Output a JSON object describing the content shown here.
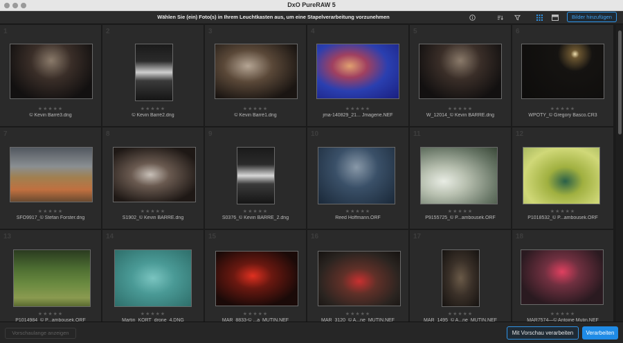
{
  "window": {
    "title": "DxO PureRAW 5"
  },
  "toolbar": {
    "instruction": "Wählen Sie (ein) Foto(s) in Ihrem Leuchtkasten aus, um eine Stapelverarbeitung vorzunehmen",
    "add_button": "Bilder hinzufügen",
    "icons": [
      "info-icon",
      "sort-icon",
      "filter-icon",
      "grid-view-icon",
      "compare-view-icon"
    ]
  },
  "rating_glyphs": "★★★★★",
  "images": [
    {
      "num": "1",
      "name": "© Kevin Barré3.dng"
    },
    {
      "num": "2",
      "name": "© Kevin Barré2.dng"
    },
    {
      "num": "3",
      "name": "© Kevin Barré1.dng"
    },
    {
      "num": "4",
      "name": "jma-140829_21... Jmagerie.NEF"
    },
    {
      "num": "5",
      "name": "W_12014_© Kevin BARRE.dng"
    },
    {
      "num": "6",
      "name": "WPOTY_© Gregory Basco.CR3"
    },
    {
      "num": "7",
      "name": "SFO9917_© Stefan Forster.dng"
    },
    {
      "num": "8",
      "name": "S1902_© Kevin BARRE.dng"
    },
    {
      "num": "9",
      "name": "S0376_© Kevin BARRE_2.dng"
    },
    {
      "num": "10",
      "name": "Reed Hoffmann.ORF"
    },
    {
      "num": "11",
      "name": "P9155725_© P...ambousek.ORF"
    },
    {
      "num": "12",
      "name": "P1018532_© P...ambousek.ORF"
    },
    {
      "num": "13",
      "name": "P1014984_© P...ambousek.ORF"
    },
    {
      "num": "14",
      "name": "Martin_KORT_drone_4.DNG"
    },
    {
      "num": "15",
      "name": "MAR_8833-© ...a_MUTIN.NEF"
    },
    {
      "num": "16",
      "name": "MAR_3120_© A...ne_MUTIN.NEF"
    },
    {
      "num": "17",
      "name": "MAR_1495_© A...ne_MUTIN.NEF"
    },
    {
      "num": "18",
      "name": "MAR7574—© Antoine Mutin.NEF"
    }
  ],
  "footer": {
    "preview_button": "Vorschaulange anzeigen",
    "process_preview_button": "Mit Vorschau verarbeiten",
    "process_button": "Verarbeiten"
  }
}
